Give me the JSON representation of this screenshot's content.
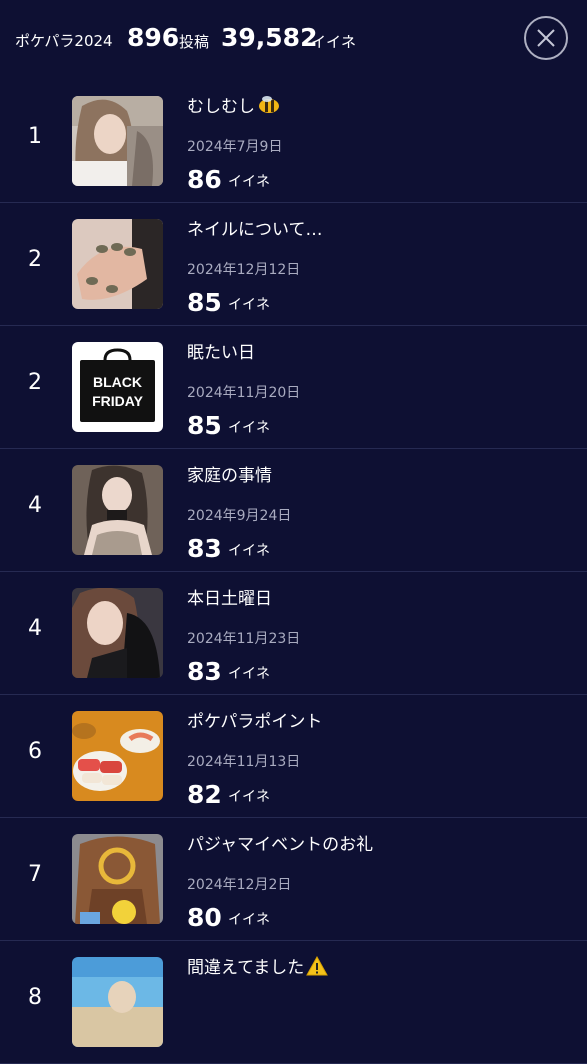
{
  "header": {
    "title": "ポケパラ2024",
    "posts_count": "896",
    "posts_unit": "投稿",
    "likes_count": "39,582",
    "likes_unit": "イイネ",
    "close_icon": "close-icon"
  },
  "colors": {
    "background": "#0e1033",
    "divider": "#262a52",
    "date_text": "#a9abc0"
  },
  "posts": [
    {
      "rank": "1",
      "title": "むしむし",
      "title_emoji": "bee-emoji",
      "date": "2024年7月9日",
      "likes": "86",
      "likes_unit": "イイネ",
      "thumb": "woman-photo"
    },
    {
      "rank": "2",
      "title": "ネイルについて…",
      "date": "2024年12月12日",
      "likes": "85",
      "likes_unit": "イイネ",
      "thumb": "nails-photo"
    },
    {
      "rank": "2",
      "title": "眠たい日",
      "date": "2024年11月20日",
      "likes": "85",
      "likes_unit": "イイネ",
      "thumb": "black-friday-image",
      "thumb_text_1": "BLACK",
      "thumb_text_2": "FRIDAY"
    },
    {
      "rank": "4",
      "title": "家庭の事情",
      "date": "2024年9月24日",
      "likes": "83",
      "likes_unit": "イイネ",
      "thumb": "woman-photo"
    },
    {
      "rank": "4",
      "title": "本日土曜日",
      "date": "2024年11月23日",
      "likes": "83",
      "likes_unit": "イイネ",
      "thumb": "woman-photo"
    },
    {
      "rank": "6",
      "title": "ポケパラポイント",
      "date": "2024年11月13日",
      "likes": "82",
      "likes_unit": "イイネ",
      "thumb": "sushi-photo"
    },
    {
      "rank": "7",
      "title": "パジャマイベントのお礼",
      "date": "2024年12月2日",
      "likes": "80",
      "likes_unit": "イイネ",
      "thumb": "costume-photo"
    },
    {
      "rank": "8",
      "title": "間違えてました",
      "title_emoji": "warning-emoji",
      "thumb": "beach-photo"
    }
  ]
}
